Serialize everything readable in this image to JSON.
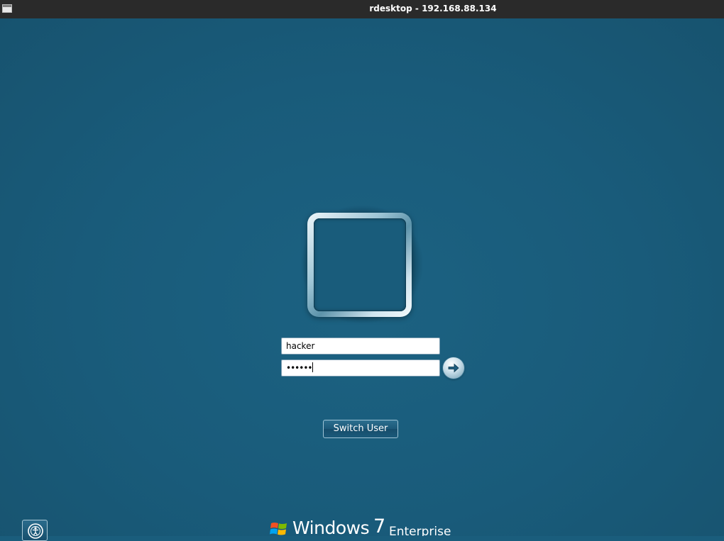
{
  "window": {
    "title": "rdesktop - 192.168.88.134",
    "icon": "window-icon"
  },
  "login": {
    "avatar": "user-tile",
    "username_value": "hacker",
    "password_mask": "••••••",
    "submit_icon": "arrow-right-icon",
    "switch_user_label": "Switch User",
    "ease_of_access_icon": "ease-of-access-icon"
  },
  "branding": {
    "windows_text": "Windows",
    "version_text": "7",
    "edition_text": "Enterprise"
  },
  "colors": {
    "background": "#1a5d7c",
    "titlebar": "#2a2a2a"
  }
}
